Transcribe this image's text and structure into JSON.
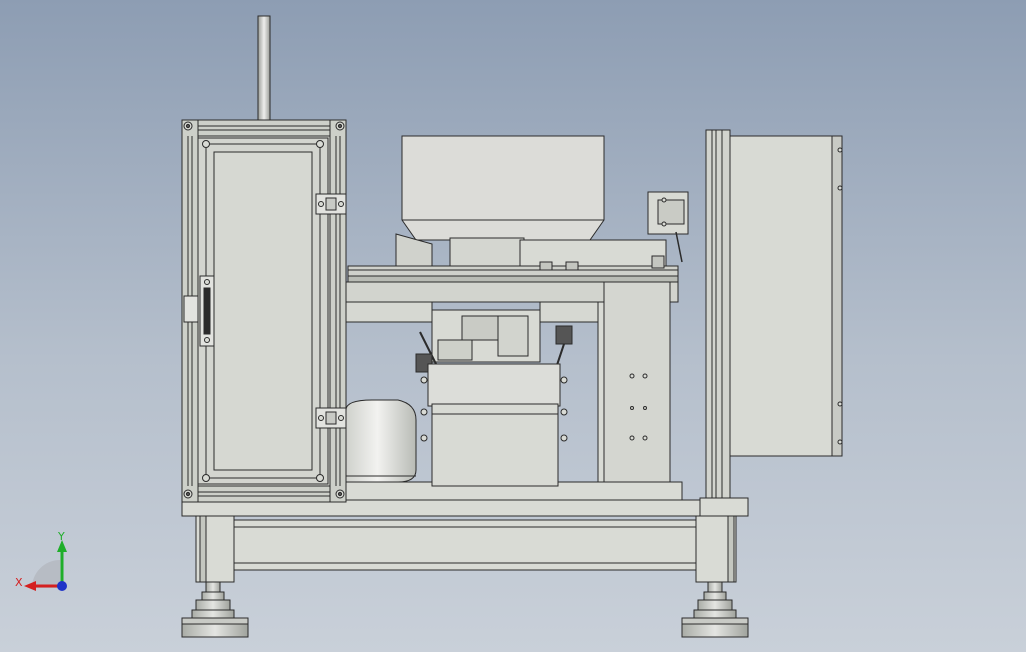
{
  "viewport": {
    "background_top": "#8d9db3",
    "background_bottom": "#c9d0d9"
  },
  "triad": {
    "x_label": "X",
    "y_label": "Y",
    "x_color": "#d42020",
    "y_color": "#1fae2a",
    "z_color": "#1f33c8"
  },
  "model": {
    "body_color": "#d9dbd5",
    "edge_color": "#2b2b2b",
    "shade_color": "#b9bcb5"
  }
}
